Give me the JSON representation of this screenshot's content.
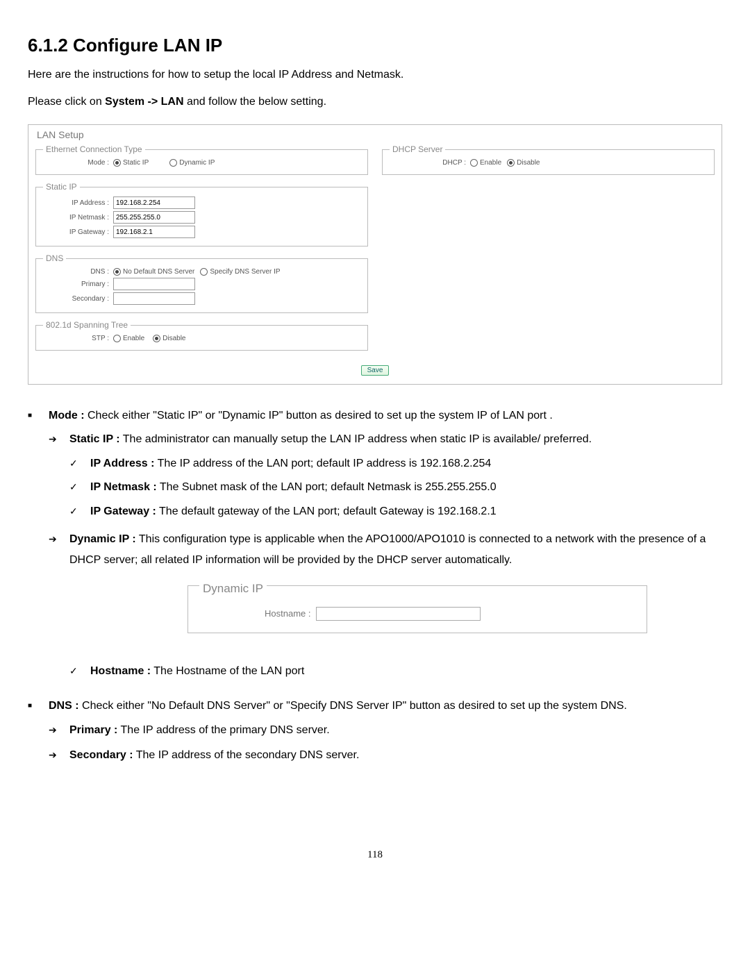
{
  "heading": "6.1.2 Configure LAN IP",
  "intro1": "Here are the instructions for how to setup the local IP Address and Netmask.",
  "intro2_prefix": "Please click on ",
  "intro2_bold": "System -> LAN",
  "intro2_suffix": " and follow the below setting.",
  "lan_setup": {
    "title": "LAN Setup",
    "ethernet": {
      "legend": "Ethernet Connection Type",
      "mode_label": "Mode :",
      "static_label": "Static IP",
      "dynamic_label": "Dynamic IP"
    },
    "dhcp": {
      "legend": "DHCP Server",
      "label": "DHCP :",
      "enable": "Enable",
      "disable": "Disable"
    },
    "static_ip": {
      "legend": "Static IP",
      "ip_label": "IP Address :",
      "ip_value": "192.168.2.254",
      "netmask_label": "IP Netmask :",
      "netmask_value": "255.255.255.0",
      "gateway_label": "IP Gateway :",
      "gateway_value": "192.168.2.1"
    },
    "dns": {
      "legend": "DNS",
      "label": "DNS :",
      "no_default": "No Default DNS Server",
      "specify": "Specify DNS Server IP",
      "primary_label": "Primary :",
      "secondary_label": "Secondary :"
    },
    "stp": {
      "legend": "802.1d Spanning Tree",
      "label": "STP :",
      "enable": "Enable",
      "disable": "Disable"
    },
    "save_button": "Save"
  },
  "desc": {
    "mode_t": "Mode :",
    "mode_d": " Check either \"Static IP\" or \"Dynamic IP\" button as desired to set up the system IP of LAN port .",
    "static_t": "Static IP :",
    "static_d": " The administrator can manually setup the LAN IP address when static IP is available/ preferred.",
    "ipaddr_t": "IP Address :",
    "ipaddr_d": " The IP address of the LAN port; default IP address is 192.168.2.254",
    "ipnet_t": "IP Netmask :",
    "ipnet_d": " The Subnet mask of the LAN port; default Netmask is 255.255.255.0",
    "ipgw_t": "IP Gateway :",
    "ipgw_d": " The default gateway of the LAN port; default Gateway is 192.168.2.1",
    "dyn_t": "Dynamic IP :",
    "dyn_d": " This configuration type is applicable when the APO1000/APO1010 is connected to a network with the presence of a DHCP server; all related IP information will be provided by the DHCP server automatically.",
    "dynbox_legend": "Dynamic IP",
    "dynbox_host_label": "Hostname :",
    "host_t": "Hostname :",
    "host_d": " The Hostname of the LAN port",
    "dns_t": "DNS :",
    "dns_d": " Check either \"No Default DNS Server\" or \"Specify DNS Server IP\" button as desired to set up the system DNS.",
    "prim_t": "Primary :",
    "prim_d": " The IP address of the primary DNS server.",
    "sec_t": "Secondary :",
    "sec_d": " The IP address of the secondary DNS server."
  },
  "page_number": "118"
}
